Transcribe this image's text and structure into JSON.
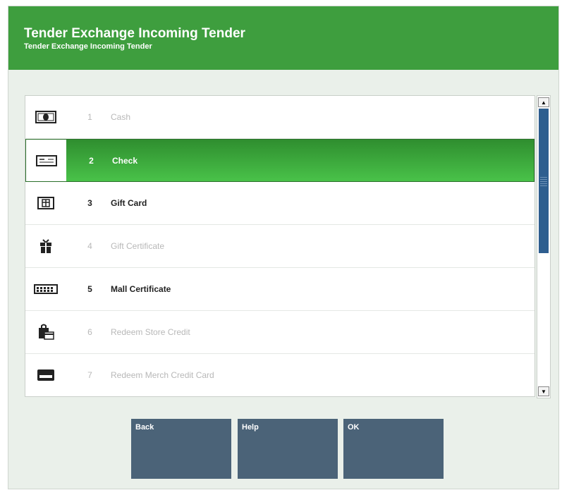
{
  "header": {
    "title": "Tender Exchange Incoming Tender",
    "subtitle": "Tender Exchange Incoming Tender"
  },
  "tenders": [
    {
      "number": "1",
      "label": "Cash",
      "icon": "cash-icon",
      "state": "disabled"
    },
    {
      "number": "2",
      "label": "Check",
      "icon": "check-icon",
      "state": "selected"
    },
    {
      "number": "3",
      "label": "Gift Card",
      "icon": "gift-card-icon",
      "state": "enabled"
    },
    {
      "number": "4",
      "label": "Gift Certificate",
      "icon": "gift-box-icon",
      "state": "disabled"
    },
    {
      "number": "5",
      "label": "Mall Certificate",
      "icon": "keyboard-icon",
      "state": "enabled"
    },
    {
      "number": "6",
      "label": "Redeem Store Credit",
      "icon": "store-credit-bag-icon",
      "state": "disabled"
    },
    {
      "number": "7",
      "label": "Redeem Merch Credit Card",
      "icon": "credit-card-icon",
      "state": "disabled"
    }
  ],
  "scrollbar": {
    "up_glyph": "▲",
    "down_glyph": "▼"
  },
  "buttons": {
    "back": "Back",
    "help": "Help",
    "ok": "OK"
  },
  "colors": {
    "header": "#3e9e3e",
    "selected": "#49c249",
    "button": "#4b6378",
    "thumb": "#2e5e8f"
  }
}
